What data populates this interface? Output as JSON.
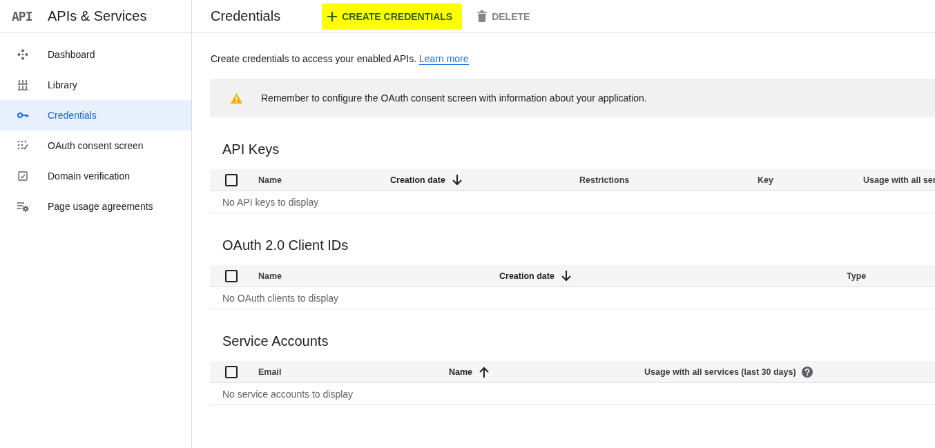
{
  "app": {
    "logo": "API",
    "title": "APIs & Services"
  },
  "sidebar": {
    "items": [
      {
        "label": "Dashboard",
        "selected": false
      },
      {
        "label": "Library",
        "selected": false
      },
      {
        "label": "Credentials",
        "selected": true
      },
      {
        "label": "OAuth consent screen",
        "selected": false
      },
      {
        "label": "Domain verification",
        "selected": false
      },
      {
        "label": "Page usage agreements",
        "selected": false
      }
    ]
  },
  "header": {
    "title": "Credentials",
    "actions": [
      {
        "kind": "create",
        "label": "CREATE CREDENTIALS",
        "disabled": false,
        "highlighted": true
      },
      {
        "kind": "delete",
        "label": "DELETE",
        "disabled": true,
        "highlighted": false
      }
    ]
  },
  "intro": {
    "text": "Create credentials to access your enabled APIs.",
    "link": "Learn more"
  },
  "alert": {
    "text": "Remember to configure the OAuth consent screen with information about your application."
  },
  "sections": [
    {
      "title": "API Keys",
      "table": {
        "select_all": {
          "checked": false
        },
        "columns": [
          {
            "label": "Name",
            "sorted": false
          },
          {
            "label": "Creation date",
            "sorted": true,
            "ascending": false
          },
          {
            "label": "Restrictions",
            "sorted": false
          },
          {
            "label": "Key",
            "sorted": false
          },
          {
            "label": "Usage with all ser",
            "sorted": false
          }
        ],
        "empty_text": "No API keys to display"
      }
    },
    {
      "title": "OAuth 2.0 Client IDs",
      "table": {
        "select_all": {
          "checked": false
        },
        "columns": [
          {
            "label": "Name",
            "sorted": false
          },
          {
            "label": "Creation date",
            "sorted": true,
            "ascending": false
          },
          {
            "label": "Type",
            "sorted": false
          }
        ],
        "empty_text": "No OAuth clients to display"
      }
    },
    {
      "title": "Service Accounts",
      "table": {
        "select_all": {
          "checked": false
        },
        "columns": [
          {
            "label": "Email",
            "sorted": false
          },
          {
            "label": "Name",
            "sorted": true,
            "ascending": true
          },
          {
            "label": "Usage with all services (last 30 days)",
            "sorted": false,
            "help": true
          }
        ],
        "empty_text": "No service accounts to display"
      }
    }
  ]
}
